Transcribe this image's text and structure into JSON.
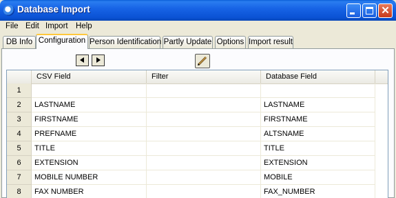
{
  "window": {
    "title": "Database Import"
  },
  "menu": [
    "File",
    "Edit",
    "Import",
    "Help"
  ],
  "tabs": [
    {
      "label": "DB Info",
      "active": false
    },
    {
      "label": "Configuration",
      "active": true
    },
    {
      "label": "Person Identification",
      "active": false
    },
    {
      "label": "Partly Update",
      "active": false
    },
    {
      "label": "Options",
      "active": false
    },
    {
      "label": "Import result",
      "active": false
    }
  ],
  "toolbar": {
    "icons": [
      "arrow-left-icon",
      "arrow-right-icon",
      "pencil-icon"
    ]
  },
  "grid": {
    "columns": [
      "CSV Field",
      "Filter",
      "Database Field"
    ],
    "rows": [
      {
        "num": "1",
        "csv": "",
        "filter": "",
        "db": ""
      },
      {
        "num": "2",
        "csv": "LASTNAME",
        "filter": "",
        "db": "LASTNAME"
      },
      {
        "num": "3",
        "csv": "FIRSTNAME",
        "filter": "",
        "db": "FIRSTNAME"
      },
      {
        "num": "4",
        "csv": "PREFNAME",
        "filter": "",
        "db": "ALTSNAME"
      },
      {
        "num": "5",
        "csv": "TITLE",
        "filter": "",
        "db": "TITLE"
      },
      {
        "num": "6",
        "csv": "EXTENSION",
        "filter": "",
        "db": "EXTENSION"
      },
      {
        "num": "7",
        "csv": "MOBILE NUMBER",
        "filter": "",
        "db": "MOBILE"
      },
      {
        "num": "8",
        "csv": "FAX NUMBER",
        "filter": "",
        "db": "FAX_NUMBER"
      }
    ]
  }
}
